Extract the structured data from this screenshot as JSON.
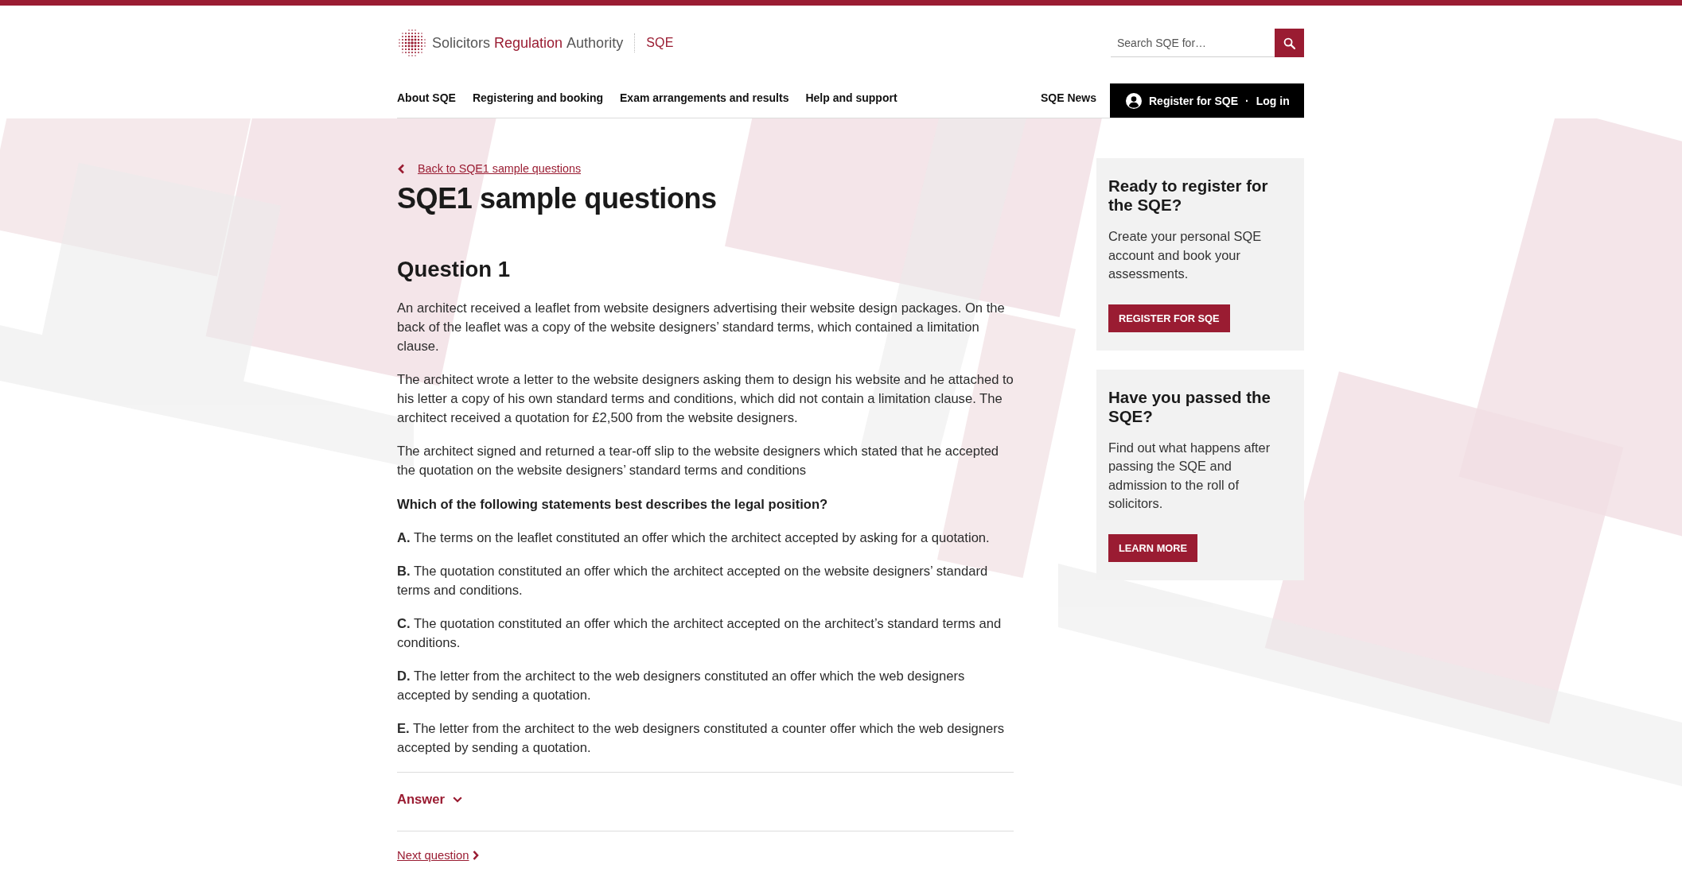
{
  "brand": {
    "logo_words": [
      {
        "text": "Solicitors",
        "accent": false
      },
      {
        "text": "Regulation",
        "accent": true
      },
      {
        "text": "Authority",
        "accent": false
      }
    ],
    "section": "SQE"
  },
  "search": {
    "placeholder": "Search SQE for…"
  },
  "nav": {
    "items": [
      "About SQE",
      "Registering and booking",
      "Exam arrangements and results",
      "Help and support"
    ],
    "news_link": "SQE News",
    "account": {
      "register": "Register for SQE",
      "separator": "·",
      "login": "Log in"
    }
  },
  "back_link": "Back to SQE1 sample questions",
  "title": "SQE1 sample questions",
  "question": {
    "heading": "Question 1",
    "paragraphs": [
      "An architect received a leaflet from website designers advertising their website design packages. On the back of the leaflet was a copy of the website designers’ standard terms, which contained a limitation clause.",
      "The architect wrote a letter to the website designers asking them to design his website and he attached to his letter a copy of his own standard terms and conditions, which did not contain a limitation clause. The architect received a quotation for £2,500 from the website designers.",
      "The architect signed and returned a tear-off slip to the website designers which stated that he accepted the quotation on the website designers’ standard terms and conditions"
    ],
    "prompt": "Which of the following statements best describes the legal position?",
    "options": [
      "**A.** The terms on the leaflet constituted an offer which the architect accepted by asking for a quotation.",
      "**B.** The quotation constituted an offer which the architect accepted on the website designers’ standard terms and conditions.",
      "**C.** The quotation constituted an offer which the architect accepted on the architect’s standard terms and conditions.",
      "**D.** The letter from the architect to the web designers constituted an offer which the web designers accepted by sending a quotation.",
      "**E.** The letter from the architect to the web designers constituted a counter offer which the web designers accepted by sending a quotation."
    ],
    "answer": {
      "label": "Answer",
      "expanded": false
    }
  },
  "next_link": "Next question",
  "sidebar": {
    "cards": [
      {
        "title": "Ready to register for the SQE?",
        "body": "Create your personal SQE account and book your assessments.",
        "button": "REGISTER FOR SQE"
      },
      {
        "title": "Have you passed the SQE?",
        "body": "Find out what happens after passing the SQE and admission to the roll of solicitors.",
        "button": "LEARN MORE"
      }
    ]
  }
}
